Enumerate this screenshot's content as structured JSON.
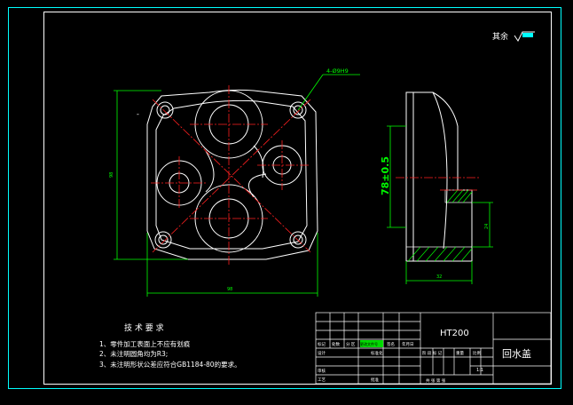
{
  "colors": {
    "background": "#000000",
    "frame": "#00ffff",
    "outline": "#ffffff",
    "center_line": "#ff2020",
    "dimension": "#00ff00",
    "note_text": "#ffffff",
    "title_block": "#ffffff",
    "hatch": "#00ff00"
  },
  "drawing": {
    "roughness_label": "其余",
    "hole_callout": "4-Ø9H9",
    "dim_vertical_left": "98",
    "dim_bottom_width": "98",
    "dim_height_tol": "78±0.5",
    "dim_side_small": "24",
    "dim_side_bottom": "32",
    "tech_requirements": {
      "title": "技 术 要 求",
      "items": [
        "1、零件加工表面上不应有划痕",
        "2、未注明圆角均为R3;",
        "3、未注明形状公差应符合GB1184-80的要求。"
      ]
    }
  },
  "title_block": {
    "material": "HT200",
    "part_name": "回水盖",
    "scale": "1:1",
    "labels": {
      "mark": "标记",
      "count": "处数",
      "zone": "分 区",
      "change_doc": "更改文件号",
      "sign": "签名",
      "date": "年月日",
      "design": "设计",
      "standardize": "标准化",
      "audit": "审核",
      "process": "工艺",
      "approve": "批准",
      "stage_mark": "阶 段 标 记",
      "weight": "重量",
      "scale_label": "比例",
      "sheets": "共    张  第    张"
    }
  }
}
